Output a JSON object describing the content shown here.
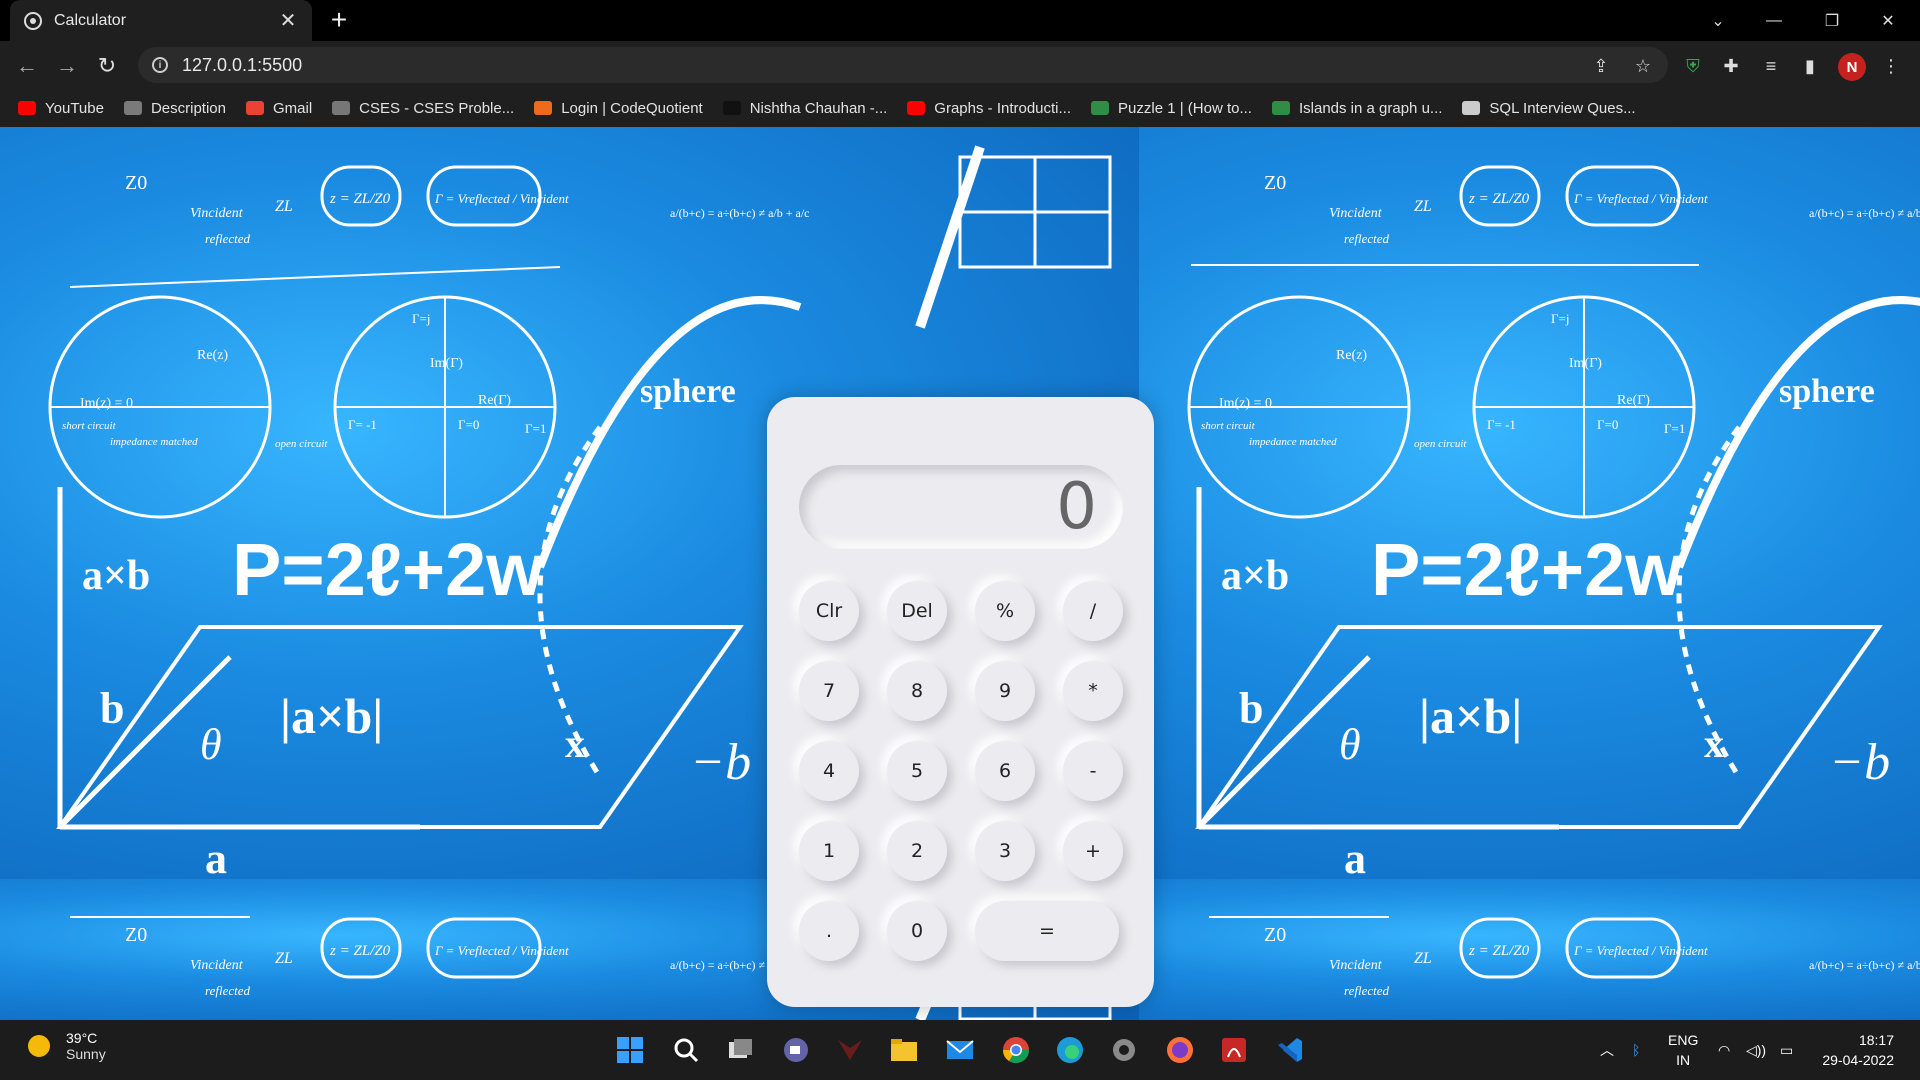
{
  "browser": {
    "tab_title": "Calculator",
    "tab_close": "✕",
    "new_tab": "+",
    "url": "127.0.0.1:5500",
    "profile_initial": "N",
    "bookmarks": [
      {
        "label": "YouTube",
        "icon": "youtube-icon",
        "color": "#ff0000"
      },
      {
        "label": "Description",
        "icon": "bolt-icon",
        "color": "#7a7a7a"
      },
      {
        "label": "Gmail",
        "icon": "gmail-icon",
        "color": "#ea4335"
      },
      {
        "label": "CSES - CSES Proble...",
        "icon": "globe-icon",
        "color": "#777777"
      },
      {
        "label": "Login | CodeQuotient",
        "icon": "codequotient-icon",
        "color": "#f06a1c"
      },
      {
        "label": "Nishtha Chauhan -...",
        "icon": "hackerrank-icon",
        "color": "#111111"
      },
      {
        "label": "Graphs - Introducti...",
        "icon": "youtube-icon",
        "color": "#ff0000"
      },
      {
        "label": "Puzzle 1 | (How to...",
        "icon": "gfg-icon",
        "color": "#2f8d46"
      },
      {
        "label": "Islands in a graph u...",
        "icon": "gfg-icon",
        "color": "#2f8d46"
      },
      {
        "label": "SQL Interview Ques...",
        "icon": "mountain-icon",
        "color": "#cccccc"
      }
    ]
  },
  "calculator": {
    "display": "0",
    "keys": [
      {
        "label": "Clr"
      },
      {
        "label": "Del"
      },
      {
        "label": "%"
      },
      {
        "label": "/"
      },
      {
        "label": "7"
      },
      {
        "label": "8"
      },
      {
        "label": "9"
      },
      {
        "label": "*"
      },
      {
        "label": "4"
      },
      {
        "label": "5"
      },
      {
        "label": "6"
      },
      {
        "label": "-"
      },
      {
        "label": "1"
      },
      {
        "label": "2"
      },
      {
        "label": "3"
      },
      {
        "label": "+"
      },
      {
        "label": "."
      },
      {
        "label": "0"
      },
      {
        "label": "="
      }
    ]
  },
  "background_text": {
    "z0": "Z0",
    "formula": "P=2ℓ+2w",
    "axb": "a×b",
    "axb_abs": "|a×b|",
    "b": "b",
    "a": "a",
    "theta": "θ",
    "minus_b": "−b",
    "im_z": "Im(z) = 0",
    "re_z": "Re(z)",
    "im_gamma": "Im(Γ)",
    "re_gamma": "Re(Γ)",
    "gamma_zero": "Γ=0",
    "gamma_minus": "Γ= -1",
    "gamma_one": "Γ=1",
    "gamma_j": "Γ=j",
    "sphere": "sphere",
    "short_circuit": "short circuit",
    "impedance_matched": "impedance matched",
    "open_circuit": "open circuit",
    "v_incident": "Vincident",
    "reflected": "reflected",
    "zl": "ZL",
    "z_eq": "z = ZL/Z0",
    "gamma_eq": "Γ = Vreflected / Vincident",
    "fraction_eq": "a/(b+c) = a÷(b+c) ≠ a/b + a/c",
    "x": "x"
  },
  "taskbar": {
    "temperature": "39°C",
    "condition": "Sunny",
    "language_top": "ENG",
    "language_bottom": "IN",
    "time": "18:17",
    "date": "29-04-2022"
  },
  "colors": {
    "calc_bg": "#ececf0",
    "bg_blue": "#1a8fe0",
    "chrome_dark": "#1f1f1f"
  }
}
